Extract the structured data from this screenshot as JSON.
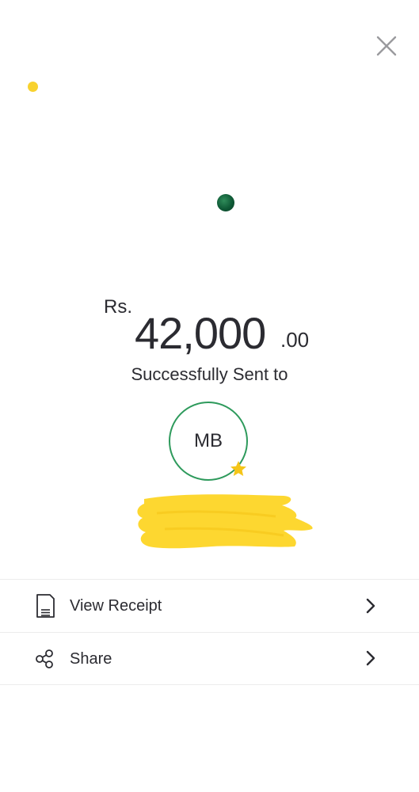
{
  "header": {
    "close_icon": "close-icon"
  },
  "transfer": {
    "currency": "Rs.",
    "amount_whole": "42,000",
    "amount_decimal": ".00",
    "status_text": "Successfully Sent to"
  },
  "recipient": {
    "initials": "MB",
    "ring_color": "#2e9a5c",
    "favorite_icon": "star-icon",
    "name_redacted": true,
    "redaction_color": "#fdd730"
  },
  "actions": [
    {
      "label": "View Receipt",
      "icon": "receipt-icon",
      "chevron": "chevron-right-icon"
    },
    {
      "label": "Share",
      "icon": "share-icon",
      "chevron": "chevron-right-icon"
    }
  ],
  "colors": {
    "text": "#2b2b31",
    "confetti_yellow": "#f8d22f",
    "confetti_green": "#0f5a36",
    "star": "#f5c518"
  }
}
